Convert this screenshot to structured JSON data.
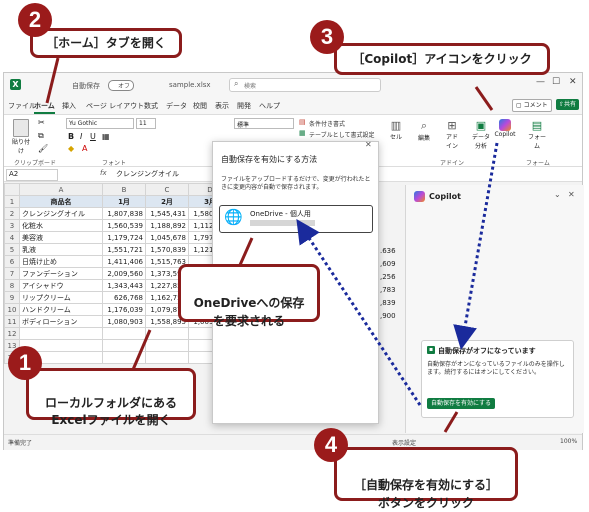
{
  "titlebar": {
    "autosave_label": "自動保存",
    "autosave_state": "オフ",
    "filename": "sample.xlsx",
    "search_placeholder": "検索"
  },
  "ribbon_tabs": [
    "ファイル",
    "ホーム",
    "挿入",
    "ページ レイアウト",
    "数式",
    "データ",
    "校閲",
    "表示",
    "開発",
    "ヘルプ"
  ],
  "ribbon_right": {
    "comment": "コメント",
    "share": "共有"
  },
  "ribbon": {
    "paste": "貼り付け",
    "clipboard_group": "クリップボード",
    "font_name": "Yu Gothic",
    "font_size": "11",
    "font_group": "フォント",
    "number_format": "標準",
    "cond_format": "条件付き書式",
    "table_format": "テーブルとして書式設定",
    "cells": "セル",
    "editing": "編集",
    "addins": "アド\nイン",
    "addin_group": "アドイン",
    "data_analysis": "データ\n分析",
    "copilot": "Copilot",
    "forms": "フォーム",
    "forms_group": "フォーム"
  },
  "formula_bar": {
    "cell_ref": "A2",
    "fx": "fx",
    "content": "クレンジングオイル"
  },
  "sheet": {
    "columns": [
      "A",
      "B",
      "C",
      "D"
    ],
    "header": [
      "商品名",
      "1月",
      "2月",
      "3月"
    ],
    "rows": [
      [
        "クレンジングオイル",
        "1,807,838",
        "1,545,431",
        "1,580,420"
      ],
      [
        "化粧水",
        "1,560,539",
        "1,188,892",
        "1,112,737"
      ],
      [
        "美容液",
        "1,179,724",
        "1,045,678",
        "1,797,879"
      ],
      [
        "乳液",
        "1,551,721",
        "1,570,839",
        "1,121,412"
      ],
      [
        "日焼け止め",
        "1,411,406",
        "1,515,763",
        "1,6"
      ],
      [
        "ファンデーション",
        "2,009,560",
        "1,373,593",
        "1,2"
      ],
      [
        "アイシャドウ",
        "1,343,443",
        "1,227,852",
        "1,4"
      ],
      [
        "リップクリーム",
        "626,768",
        "1,162,752",
        "1,2"
      ],
      [
        "ハンドクリーム",
        "1,176,039",
        "1,079,870",
        "1"
      ],
      [
        "ボディローション",
        "1,080,903",
        "1,558,895",
        "1,009,063"
      ]
    ],
    "right_edge_values": [
      "",
      "",
      "",
      ".636",
      ",609",
      ",256",
      ",783",
      ",839",
      ",900"
    ]
  },
  "popup": {
    "title": "自動保存を有効にする方法",
    "body": "ファイルをアップロードするだけで、変更が行われたときに変更内容が自動で保存されます。",
    "option_label": "OneDrive - 個人用"
  },
  "copilot_pane": {
    "title": "Copilot",
    "card_title": "自動保存がオフになっています",
    "card_body": "自動保存がオンになっているファイルのみを操作します。続行するにはオンにしてください。",
    "card_button": "自動保存を有効にする"
  },
  "status": {
    "ready": "準備完了",
    "display_settings": "表示設定",
    "zoom": "100%"
  },
  "callouts": {
    "c1": {
      "num": "1",
      "text": "ローカルフォルダにある\nExcelファイルを開く"
    },
    "c2": {
      "num": "2",
      "text": "［ホーム］タブを開く"
    },
    "c3": {
      "num": "3",
      "text": "［Copilot］アイコンをクリック"
    },
    "c4": {
      "num": "4",
      "text": "［自動保存を有効にする］\nボタンをクリック"
    },
    "c5": {
      "text": "OneDriveへの保存\nを要求される"
    }
  },
  "colors": {
    "excel_green": "#107c41",
    "callout_red": "#9b1b1b",
    "arrow_blue": "#1a2a9c"
  }
}
